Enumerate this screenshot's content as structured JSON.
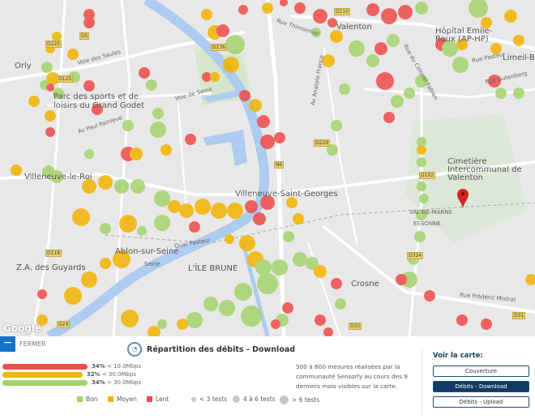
{
  "map": {
    "places": [
      "Orly",
      "Parc des sports et de loisirs du Grand Godet",
      "Valenton",
      "Hôpital Emile-Roux (AP-HP)",
      "Limeil-B",
      "Cimetière Intercommunal de Valenton",
      "Villeneuve-le-Roi",
      "Villeneuve-Saint-Georges",
      "Ablon-sur-Seine",
      "L'ÎLE BRUNE",
      "Z.A. des Guyards",
      "Crosne",
      "VAL-DE-MARNE",
      "ESSONNE",
      "Seine"
    ],
    "streets": [
      "Av Paul Painlevé",
      "Voie de Seine",
      "Voie des Saules",
      "Rue Thimonnier",
      "Av Anatole France",
      "Rue Pasteur",
      "Rue Gutenberg",
      "Rue Frédéric Mistral",
      "Quai Pasteur",
      "Rue du Colonel Fabien"
    ],
    "roads": [
      "D5",
      "D225",
      "D125",
      "D136",
      "D110",
      "D102",
      "D229",
      "N6",
      "D32",
      "D31",
      "D324",
      "D118",
      "D29"
    ],
    "attribution": "Google"
  },
  "panel": {
    "close_label": "FERMER",
    "title": "Répartition des débits - Download",
    "bars": [
      {
        "pct": "34%",
        "label": "< 10.0Mbps",
        "value": 34,
        "color": "#f04a4a"
      },
      {
        "pct": "32%",
        "label": "< 30.0Mbps",
        "value": 32,
        "color": "#f2b400"
      },
      {
        "pct": "34%",
        "label": "> 30.0Mbps",
        "value": 34,
        "color": "#a3d36c"
      }
    ],
    "legend": {
      "bon": "Bon",
      "moyen": "Moyen",
      "lent": "Lent",
      "small": "< 3 tests",
      "medium": "4 à 6 tests",
      "large": "> 6 tests"
    },
    "colors": {
      "bon": "#a3d36c",
      "moyen": "#f2b400",
      "lent": "#f04a4a"
    },
    "info": "500 à 600 mesures réalisées par la communauté Sensorly au cours des 9 derniers mois visibles sur la carte.",
    "voir_title": "Voir la carte:",
    "buttons": [
      "Couverture",
      "Débits - Download",
      "Débits - Upload"
    ]
  }
}
